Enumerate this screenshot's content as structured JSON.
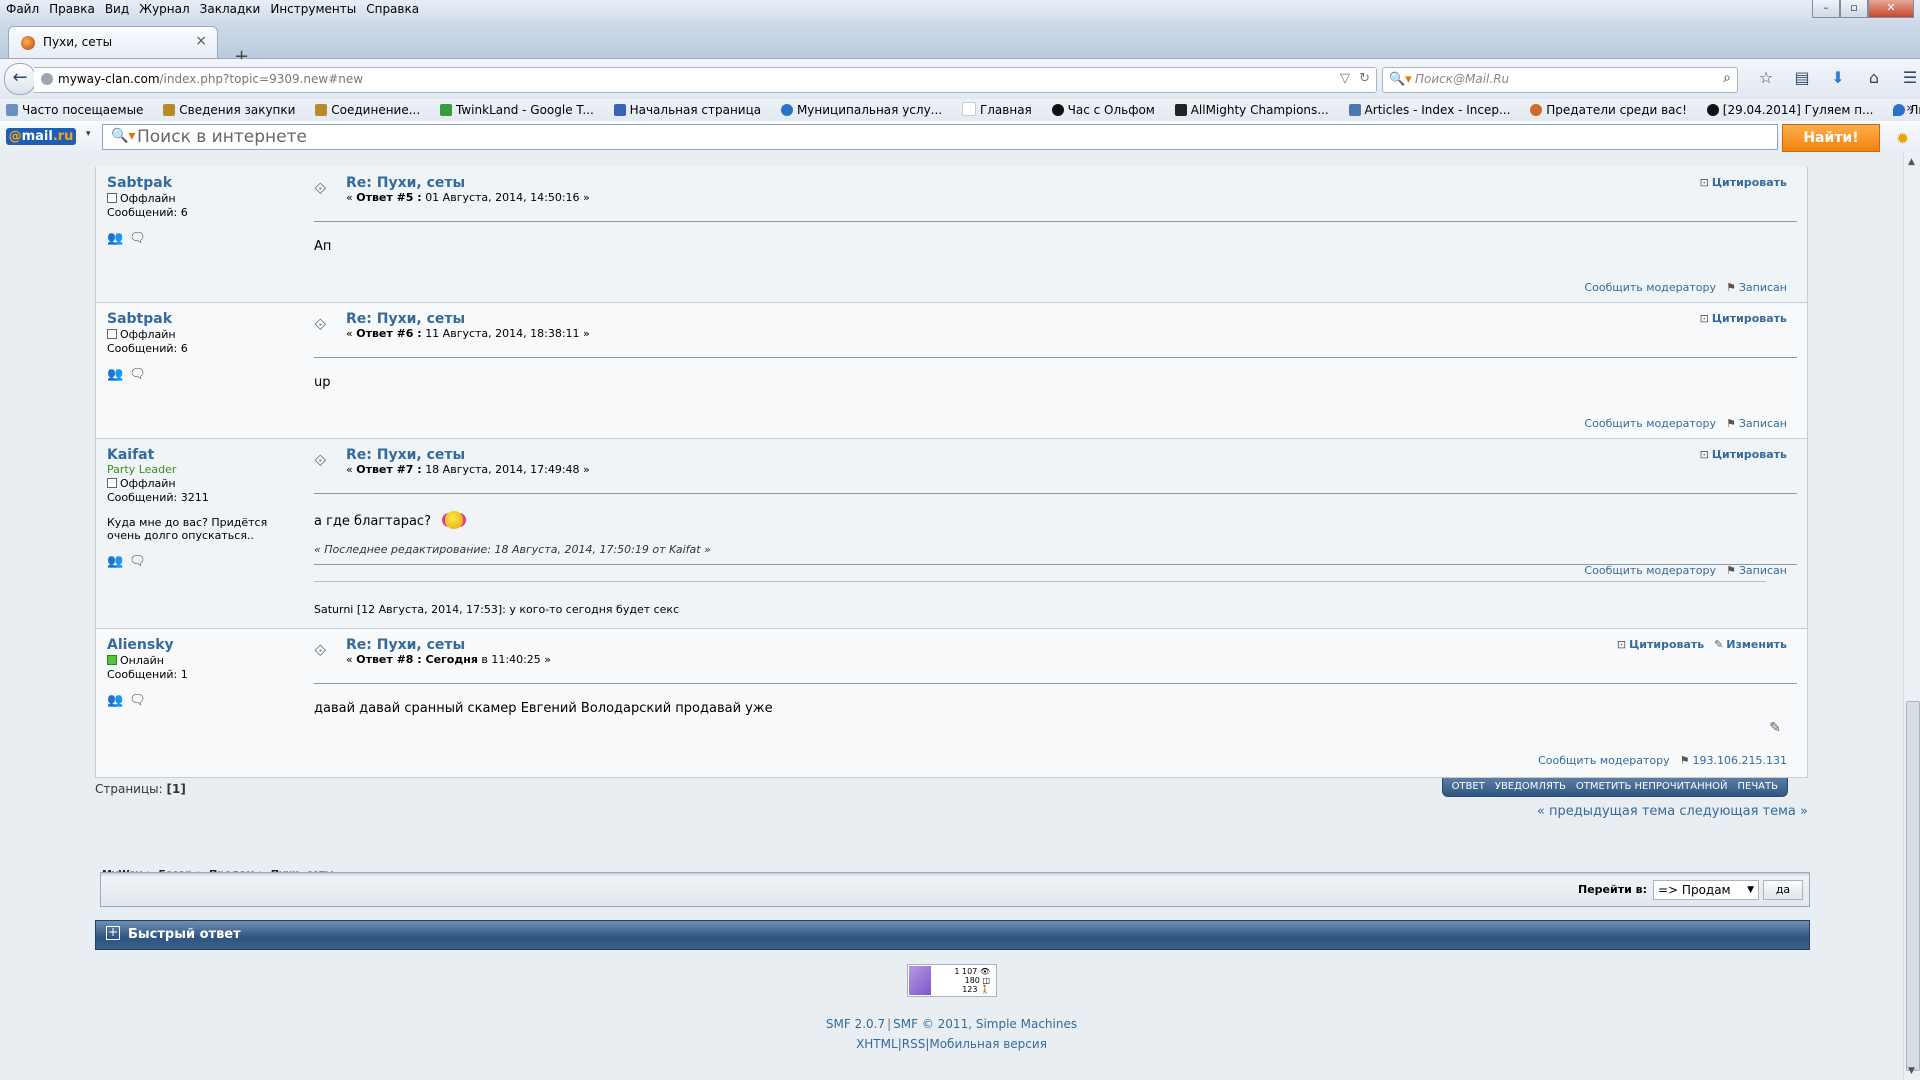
{
  "menu": [
    "Файл",
    "Правка",
    "Вид",
    "Журнал",
    "Закладки",
    "Инструменты",
    "Справка"
  ],
  "tab": {
    "title": "Пухи, сеты",
    "close": "×",
    "new": "+"
  },
  "url": {
    "host": "myway-clan.com",
    "path": "/index.php?topic=9309.new#new"
  },
  "search": {
    "placeholder": "Поиск@Mail.Ru"
  },
  "bookmarks": [
    "Часто посещаемые",
    "Сведения закупки",
    "Соединение...",
    "TwinkLand - Google T...",
    "Начальная страница",
    "Муниципальная услу...",
    "Главная",
    "Час с Ольфом",
    "AllMighty Champions...",
    "Articles - Index - Incep...",
    "Предатели среди вас!",
    "[29.04.2014] Гуляем п...",
    "Личный кабинет \"Рос..."
  ],
  "mailbar": {
    "logo_a": "@",
    "logo_b": "mail",
    "logo_c": ".ru",
    "placeholder": "Поиск в интернете",
    "find": "Найти!"
  },
  "labels": {
    "quote": "Цитировать",
    "edit": "Изменить",
    "report": "Сообщить модератору",
    "logged": "Записан",
    "offline": "Оффлайн",
    "online": "Онлайн"
  },
  "posts": [
    {
      "author": "Sabtpak",
      "status": "Оффлайн",
      "posts": "Сообщений: 6",
      "title": "Re: Пухи, сеты",
      "num": "Ответ #5 :",
      "date": "01 Августа, 2014, 14:50:16",
      "text": "Ап"
    },
    {
      "author": "Sabtpak",
      "status": "Оффлайн",
      "posts": "Сообщений: 6",
      "title": "Re: Пухи, сеты",
      "num": "Ответ #6 :",
      "date": "11 Августа, 2014, 18:38:11",
      "text": "up"
    },
    {
      "author": "Kaifat",
      "rank": "Party Leader",
      "status": "Оффлайн",
      "posts": "Сообщений: 3211",
      "sig_text": "Куда мне до вас? Придётся очень долго опускаться..",
      "title": "Re: Пухи, сеты",
      "num": "Ответ #7 :",
      "date": "18 Августа, 2014, 17:49:48",
      "text": "а где благтарас?",
      "edited": "« Последнее редактирование: 18 Августа, 2014, 17:50:19 от Kaifat »",
      "signature": "Saturni [12 Августа, 2014, 17:53]:    у кого-то сегодня будет секс"
    },
    {
      "author": "Aliensky",
      "status": "Онлайн",
      "posts": "Сообщений: 1",
      "title": "Re: Пухи, сеты",
      "num": "Ответ #8 : Сегодня",
      "date": " в 11:40:25",
      "text": "давай давай сранный скамер Евгений Володарский продавай уже",
      "ip": "193.106.215.131"
    }
  ],
  "pagination": {
    "label": "Страницы:",
    "current": "[1]",
    "buttons": [
      "Ответ",
      "Уведомлять",
      "Отметить непрочитанной",
      "Печать"
    ],
    "prevnext": "« предыдущая тема следующая тема »"
  },
  "linktree": [
    "MyWay",
    "Базар",
    "Продам",
    "Пухи, сеты"
  ],
  "jump": {
    "label": "Перейти в:",
    "value": "=> Продам",
    "go": "да"
  },
  "quickreply": "Быстрый ответ",
  "counter": [
    "1 107 👁",
    "180 ◫",
    "123 🚶"
  ],
  "footer": {
    "a": "SMF 2.0.7",
    "b": "SMF © 2011, Simple Machines",
    "c": "XHTML",
    "d": "RSS",
    "e": "Мобильная версия"
  }
}
